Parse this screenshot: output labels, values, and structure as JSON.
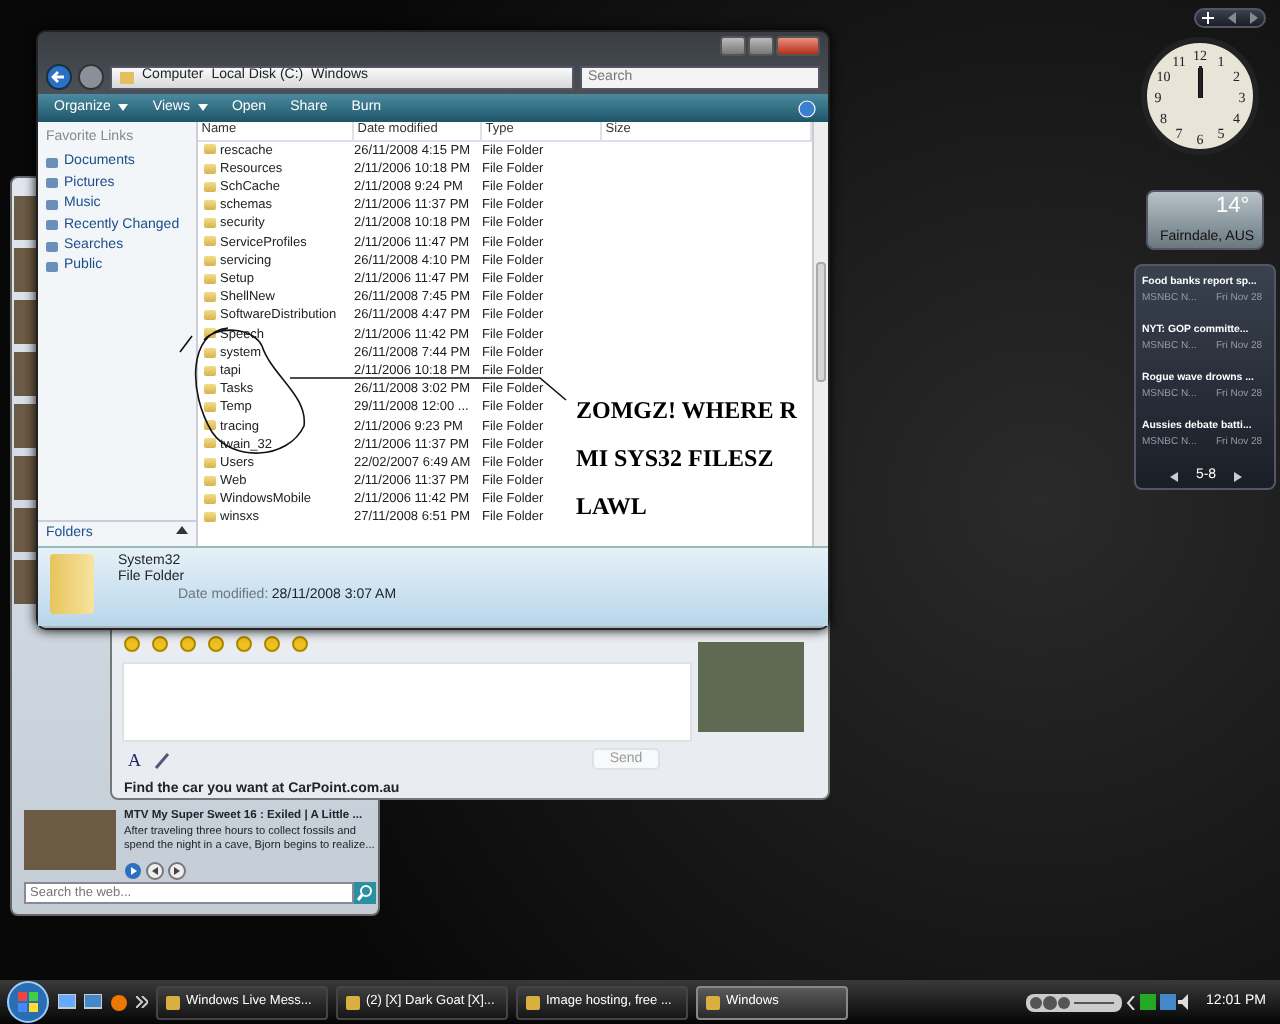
{
  "explorer": {
    "breadcrumbs": [
      "Computer",
      "Local Disk (C:)",
      "Windows"
    ],
    "search": {
      "placeholder": "Search"
    },
    "toolbar": [
      {
        "label": "Organize",
        "kind": "menu"
      },
      {
        "label": "Views",
        "kind": "menu"
      },
      {
        "label": "Open",
        "kind": "plain"
      },
      {
        "label": "Share",
        "kind": "plain"
      },
      {
        "label": "Burn",
        "kind": "plain"
      }
    ],
    "favorite_links": {
      "title": "Favorite Links",
      "items": [
        "Documents",
        "Pictures",
        "Music",
        "Recently Changed",
        "Searches",
        "Public"
      ]
    },
    "folders_label": "Folders",
    "columns": [
      "Name",
      "Date modified",
      "Type",
      "Size"
    ],
    "rows": [
      {
        "name": "rescache",
        "modified": "26/11/2008 4:15 PM",
        "type": "File Folder"
      },
      {
        "name": "Resources",
        "modified": "2/11/2006 10:18 PM",
        "type": "File Folder"
      },
      {
        "name": "SchCache",
        "modified": "2/11/2008 9:24 PM",
        "type": "File Folder"
      },
      {
        "name": "schemas",
        "modified": "2/11/2006 11:37 PM",
        "type": "File Folder"
      },
      {
        "name": "security",
        "modified": "2/11/2008 10:18 PM",
        "type": "File Folder"
      },
      {
        "name": "ServiceProfiles",
        "modified": "2/11/2006 11:47 PM",
        "type": "File Folder"
      },
      {
        "name": "servicing",
        "modified": "26/11/2008 4:10 PM",
        "type": "File Folder"
      },
      {
        "name": "Setup",
        "modified": "2/11/2006 11:47 PM",
        "type": "File Folder"
      },
      {
        "name": "ShellNew",
        "modified": "26/11/2008 7:45 PM",
        "type": "File Folder"
      },
      {
        "name": "SoftwareDistribution",
        "modified": "26/11/2008 4:47 PM",
        "type": "File Folder"
      },
      {
        "name": "Speech",
        "modified": "2/11/2006 11:42 PM",
        "type": "File Folder"
      },
      {
        "name": "system",
        "modified": "26/11/2008 7:44 PM",
        "type": "File Folder"
      },
      {
        "name": "tapi",
        "modified": "2/11/2006 10:18 PM",
        "type": "File Folder"
      },
      {
        "name": "Tasks",
        "modified": "26/11/2008 3:02 PM",
        "type": "File Folder"
      },
      {
        "name": "Temp",
        "modified": "29/11/2008 12:00 ...",
        "type": "File Folder"
      },
      {
        "name": "tracing",
        "modified": "2/11/2006 9:23 PM",
        "type": "File Folder"
      },
      {
        "name": "twain_32",
        "modified": "2/11/2006 11:37 PM",
        "type": "File Folder"
      },
      {
        "name": "Users",
        "modified": "22/02/2007 6:49 AM",
        "type": "File Folder"
      },
      {
        "name": "Web",
        "modified": "2/11/2006 11:37 PM",
        "type": "File Folder"
      },
      {
        "name": "WindowsMobile",
        "modified": "2/11/2006 11:42 PM",
        "type": "File Folder"
      },
      {
        "name": "winsxs",
        "modified": "27/11/2008 6:51 PM",
        "type": "File Folder"
      }
    ],
    "details": {
      "name": "System32",
      "type": "File Folder",
      "modified_label": "Date modified:",
      "modified": "28/11/2008 3:07 AM"
    }
  },
  "annotation": {
    "text": "ZOMGZ! WHERE R MI SYS32 FILESZ LAWL"
  },
  "messenger": {
    "font_button": "A",
    "send": "Send",
    "ad": "Find the car you want at CarPoint.com.au",
    "video": {
      "title": "MTV My Super Sweet 16 : Exiled | A Little ...",
      "description": "After traveling three hours to collect fossils and spend the night in a cave, Bjorn begins to realize..."
    },
    "search": {
      "placeholder": "Search the web..."
    }
  },
  "gadgets": {
    "clock": {
      "numerals": [
        "12",
        "1",
        "2",
        "3",
        "4",
        "5",
        "6",
        "7",
        "8",
        "9",
        "10",
        "11"
      ]
    },
    "weather": {
      "temperature": "14°",
      "location": "Fairndale, AUS"
    },
    "news": {
      "items": [
        {
          "headline": "Food banks report sp...",
          "source": "MSNBC N...",
          "date": "Fri Nov 28"
        },
        {
          "headline": "NYT: GOP committe...",
          "source": "MSNBC N...",
          "date": "Fri Nov 28"
        },
        {
          "headline": "Rogue wave drowns ...",
          "source": "MSNBC N...",
          "date": "Fri Nov 28"
        },
        {
          "headline": "Aussies debate batti...",
          "source": "MSNBC N...",
          "date": "Fri Nov 28"
        }
      ],
      "pager": "5-8"
    }
  },
  "taskbar": {
    "tasks": [
      {
        "label": "Windows Live Mess...",
        "selected": false
      },
      {
        "label": "(2) [X] Dark Goat [X]...",
        "selected": false
      },
      {
        "label": "Image hosting, free ...",
        "selected": false
      },
      {
        "label": "Windows",
        "selected": true
      }
    ],
    "time": "12:01 PM"
  }
}
